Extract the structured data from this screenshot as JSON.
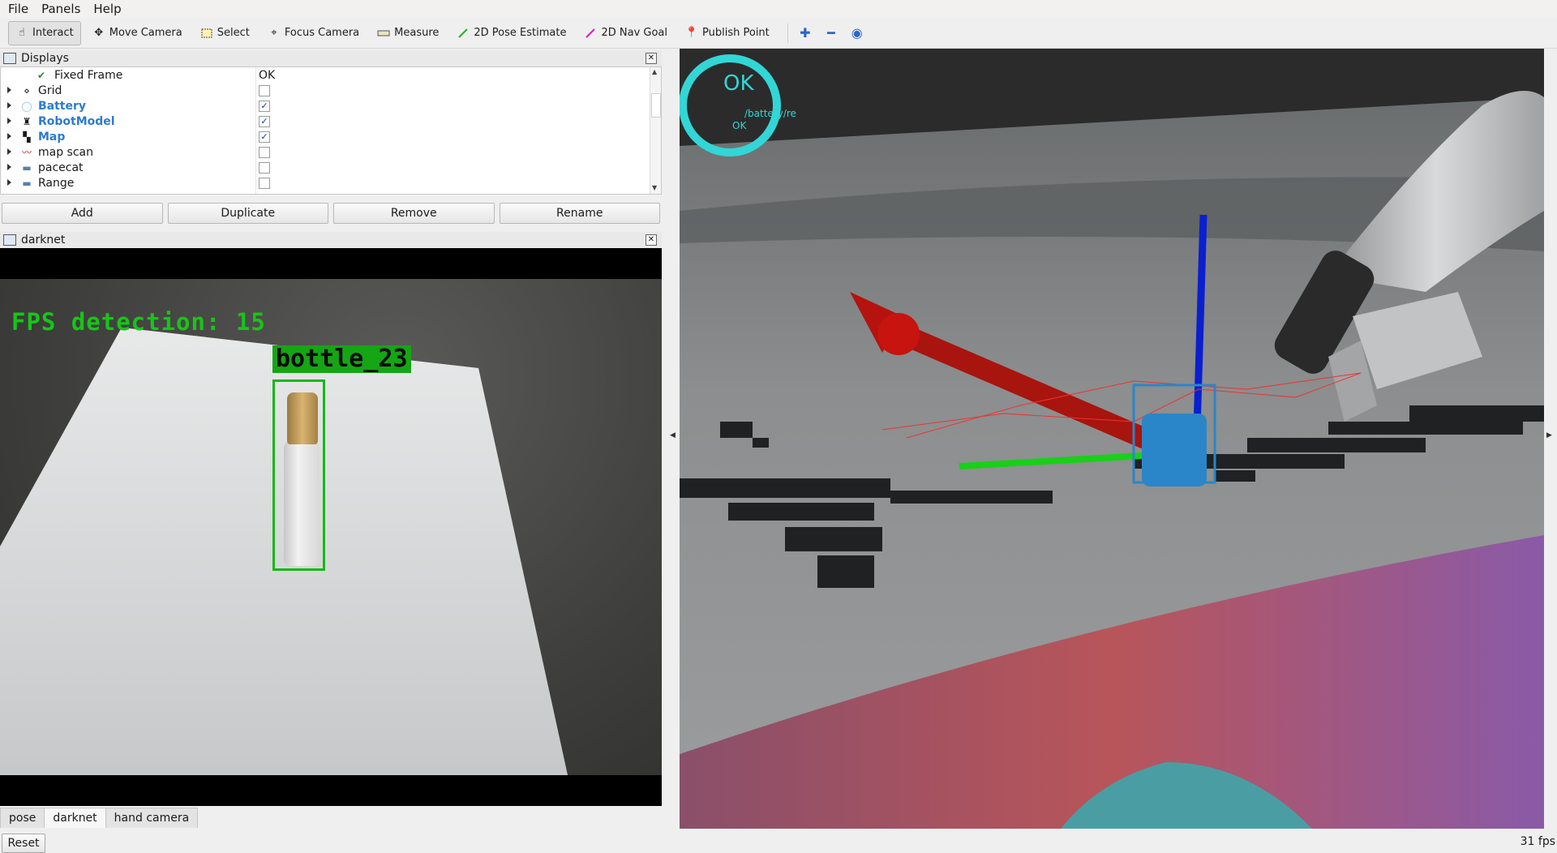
{
  "menu": {
    "file": "File",
    "panels": "Panels",
    "help": "Help"
  },
  "toolbar": {
    "interact": "Interact",
    "move_camera": "Move Camera",
    "select": "Select",
    "focus_camera": "Focus Camera",
    "measure": "Measure",
    "pose_estimate": "2D Pose Estimate",
    "nav_goal": "2D Nav Goal",
    "publish_point": "Publish Point"
  },
  "displays_panel": {
    "title": "Displays",
    "rows": [
      {
        "label": "Fixed Frame",
        "value": "OK"
      },
      {
        "label": "Grid",
        "checked": false
      },
      {
        "label": "Battery",
        "checked": true
      },
      {
        "label": "RobotModel",
        "checked": true
      },
      {
        "label": "Map",
        "checked": true
      },
      {
        "label": "map scan",
        "checked": false
      },
      {
        "label": "pacecat",
        "checked": false
      },
      {
        "label": "Range",
        "checked": false
      }
    ],
    "buttons": {
      "add": "Add",
      "duplicate": "Duplicate",
      "remove": "Remove",
      "rename": "Rename"
    }
  },
  "darknet_panel": {
    "title": "darknet",
    "fps_text": "FPS detection: 15",
    "detection_label": "bottle_23"
  },
  "bottom_tabs": [
    "pose",
    "darknet",
    "hand camera"
  ],
  "status": {
    "reset": "Reset",
    "fps": "31 fps"
  },
  "view3d": {
    "overlay_status": "OK",
    "overlay_topic": "/battery/re",
    "overlay_sub_status": "OK"
  },
  "colors": {
    "ok_cyan": "#33d6d6",
    "detection_green": "#18b818",
    "axis_red": "#b4130e",
    "axis_blue": "#0a1fd0",
    "axis_green": "#18d018",
    "marker_blue": "#2a86c8"
  }
}
